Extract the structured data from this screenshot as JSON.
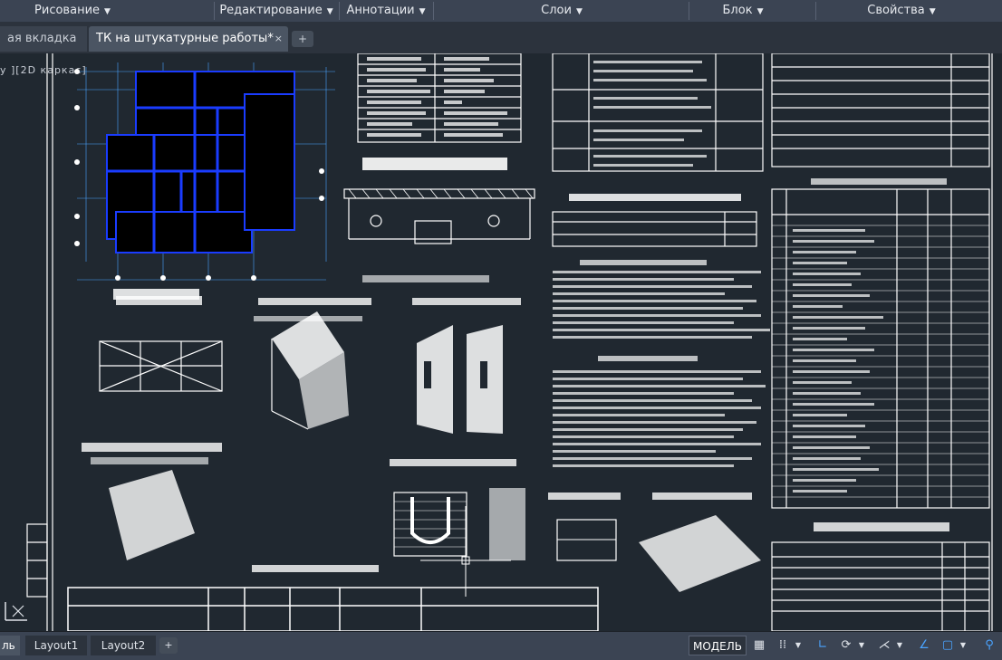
{
  "ribbon": {
    "panels": [
      {
        "label": "Рисование"
      },
      {
        "label": "Редактирование"
      },
      {
        "label": "Аннотации"
      },
      {
        "label": "Слои"
      },
      {
        "label": "Блок"
      },
      {
        "label": "Свойства"
      }
    ]
  },
  "doc_tabs": {
    "inactive_label": "ая вкладка",
    "active_label": "ТК на штукатурные работы*",
    "close_glyph": "×",
    "add_glyph": "+"
  },
  "viewport": {
    "label": "у ][2D каркас]"
  },
  "layout_tabs": {
    "model_tab": "ль",
    "layout1": "Layout1",
    "layout2": "Layout2",
    "add_glyph": "+"
  },
  "status_bar": {
    "model_label": "МОДЕЛЬ",
    "icons": [
      "grid-icon",
      "snap-icon",
      "ortho-icon",
      "polar-icon",
      "isodraft-icon",
      "osnap-track-icon",
      "annotation-scale-icon",
      "workspace-icon",
      "user-icon"
    ]
  },
  "colors": {
    "ribbon_bg": "#3b4453",
    "canvas_bg": "#202830",
    "drawing_lines": "#ffffff",
    "plan_walls": "#1a3cff",
    "accent_blue": "#4aa3ff"
  }
}
